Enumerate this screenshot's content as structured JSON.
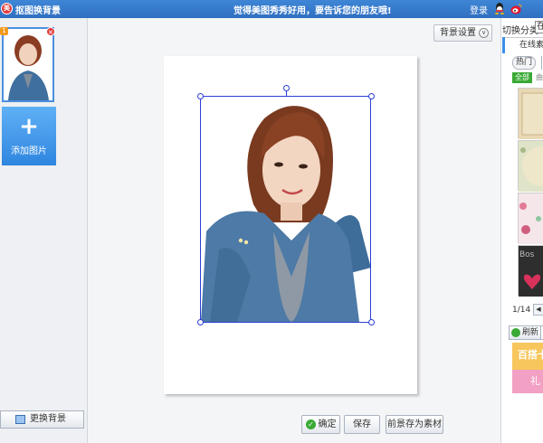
{
  "titlebar": {
    "app_logo": "美",
    "app_title": "抠图换背景",
    "promo": "觉得美图秀秀好用，要告诉您的朋友哦!",
    "login": "登录"
  },
  "left": {
    "thumb_badge": "1",
    "thumb_close": "×",
    "add_plus": "+",
    "add_label": "添加图片",
    "change_bg": "更换背景"
  },
  "center": {
    "bg_settings": "背景设置",
    "bg_settings_chevron": "∨",
    "ok_icon": "✓",
    "ok": "确定",
    "save": "保存",
    "save_fg": "前景存为素材"
  },
  "right": {
    "switch_label": "切换分类",
    "select_value": "在线素材",
    "tab": "在线素材",
    "hot": "热门",
    "all": "全部",
    "all2": "曲",
    "pager": "1/14",
    "pager_prev": "◀",
    "refresh": "刷新",
    "ad1": "百搭卡",
    "ad2": "礼"
  },
  "colors": {
    "titlebar": "#2f6fc0",
    "accent": "#3b8ee8",
    "selection": "#2b3fd6",
    "ok_green": "#3aaa35"
  }
}
